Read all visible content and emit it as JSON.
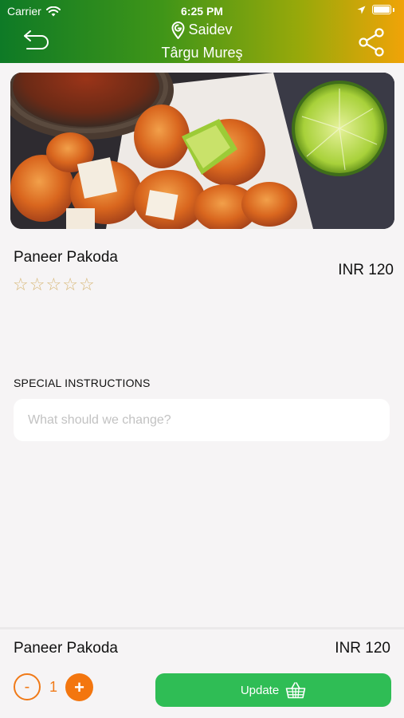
{
  "status_bar": {
    "carrier": "Carrier",
    "time": "6:25 PM"
  },
  "nav": {
    "title_line1": "Saidev",
    "title_line2": "Târgu Mureş"
  },
  "item": {
    "name": "Paneer Pakoda",
    "price": "INR 120",
    "rating_max": 5,
    "rating": 0
  },
  "special_instructions": {
    "label": "SPECIAL INSTRUCTIONS",
    "placeholder": "What should we change?",
    "value": ""
  },
  "footer": {
    "name": "Paneer Pakoda",
    "price": "INR 120",
    "minus_label": "-",
    "quantity": "1",
    "plus_label": "+",
    "update_label": "Update"
  },
  "colors": {
    "header_start": "#0e7a26",
    "header_end": "#f0a308",
    "accent_orange": "#f3760f",
    "update_green": "#2fbd55",
    "star": "#d8b878"
  },
  "icons": [
    "wifi-icon",
    "location-arrow-icon",
    "battery-icon",
    "back-icon",
    "location-pin-icon",
    "share-icon",
    "star-icon",
    "basket-icon"
  ]
}
